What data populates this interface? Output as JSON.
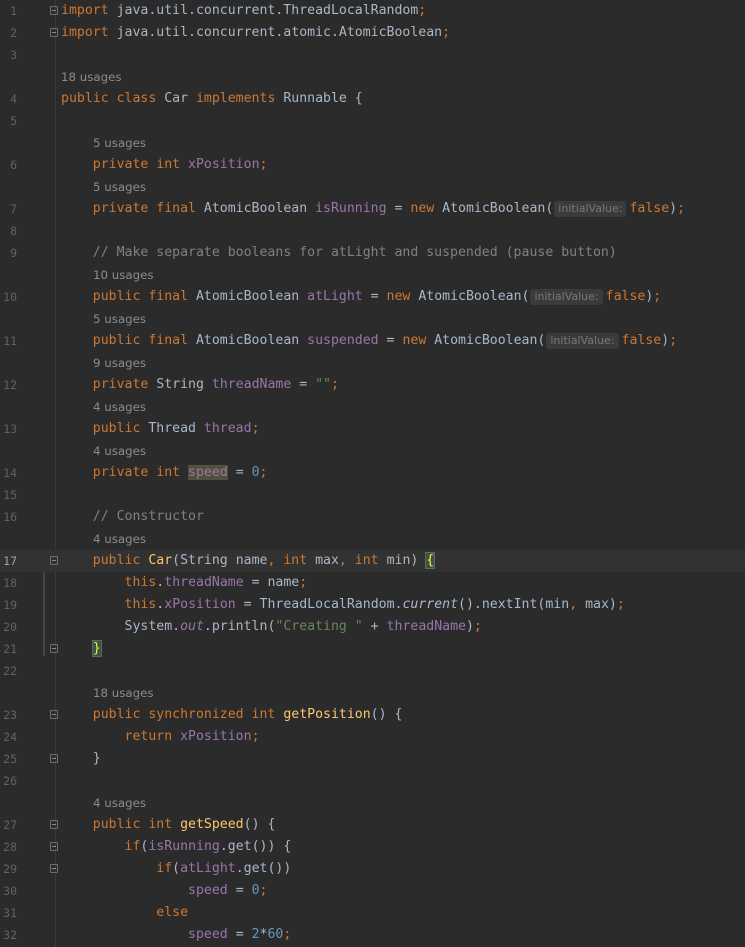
{
  "editor": {
    "language": "java",
    "colors": {
      "background": "#2b2b2b",
      "keyword": "#cc7832",
      "field": "#9876aa",
      "string": "#6a8759",
      "number": "#6897bb",
      "comment": "#808080",
      "method": "#ffc66d"
    },
    "lines": [
      {
        "num": "1",
        "fold": true,
        "tokens": [
          [
            "kw",
            "import"
          ],
          [
            "p",
            " java.util.concurrent.ThreadLocalRandom"
          ],
          [
            "kw",
            ";"
          ]
        ]
      },
      {
        "num": "2",
        "fold": true,
        "tokens": [
          [
            "kw",
            "import"
          ],
          [
            "p",
            " java.util.concurrent.atomic.AtomicBoolean"
          ],
          [
            "kw",
            ";"
          ]
        ]
      },
      {
        "num": "3",
        "tokens": []
      },
      {
        "usage": "18 usages",
        "indent": 0
      },
      {
        "num": "4",
        "tokens": [
          [
            "kw",
            "public class "
          ],
          [
            "p",
            "Car "
          ],
          [
            "kw",
            "implements "
          ],
          [
            "p",
            "Runnable {"
          ]
        ]
      },
      {
        "num": "5",
        "tokens": []
      },
      {
        "usage": "5 usages",
        "indent": 1
      },
      {
        "num": "6",
        "tokens": [
          [
            "p",
            "    "
          ],
          [
            "kw",
            "private int "
          ],
          [
            "fld",
            "xPosition"
          ],
          [
            "kw",
            ";"
          ]
        ]
      },
      {
        "usage": "5 usages",
        "indent": 1
      },
      {
        "num": "7",
        "tokens": [
          [
            "p",
            "    "
          ],
          [
            "kw",
            "private final "
          ],
          [
            "p",
            "AtomicBoolean "
          ],
          [
            "fld",
            "isRunning"
          ],
          [
            "p",
            " = "
          ],
          [
            "kw",
            "new "
          ],
          [
            "p",
            "AtomicBoolean("
          ],
          [
            "hint",
            "initialValue:"
          ],
          [
            "kw",
            "false"
          ],
          [
            "p",
            ")"
          ],
          [
            "kw",
            ";"
          ]
        ]
      },
      {
        "num": "8",
        "tokens": []
      },
      {
        "num": "9",
        "tokens": [
          [
            "p",
            "    "
          ],
          [
            "cm",
            "// Make separate booleans for atLight and suspended (pause button)"
          ]
        ]
      },
      {
        "usage": "10 usages",
        "indent": 1
      },
      {
        "num": "10",
        "tokens": [
          [
            "p",
            "    "
          ],
          [
            "kw",
            "public final "
          ],
          [
            "p",
            "AtomicBoolean "
          ],
          [
            "fld",
            "atLight"
          ],
          [
            "p",
            " = "
          ],
          [
            "kw",
            "new "
          ],
          [
            "p",
            "AtomicBoolean("
          ],
          [
            "hint",
            "initialValue:"
          ],
          [
            "kw",
            "false"
          ],
          [
            "p",
            ")"
          ],
          [
            "kw",
            ";"
          ]
        ]
      },
      {
        "usage": "5 usages",
        "indent": 1
      },
      {
        "num": "11",
        "tokens": [
          [
            "p",
            "    "
          ],
          [
            "kw",
            "public final "
          ],
          [
            "p",
            "AtomicBoolean "
          ],
          [
            "fld",
            "suspended"
          ],
          [
            "p",
            " = "
          ],
          [
            "kw",
            "new "
          ],
          [
            "p",
            "AtomicBoolean("
          ],
          [
            "hint",
            "initialValue:"
          ],
          [
            "kw",
            "false"
          ],
          [
            "p",
            ")"
          ],
          [
            "kw",
            ";"
          ]
        ]
      },
      {
        "usage": "9 usages",
        "indent": 1
      },
      {
        "num": "12",
        "tokens": [
          [
            "p",
            "    "
          ],
          [
            "kw",
            "private "
          ],
          [
            "p",
            "String "
          ],
          [
            "fld",
            "threadName"
          ],
          [
            "p",
            " = "
          ],
          [
            "str",
            "\"\""
          ],
          [
            "kw",
            ";"
          ]
        ]
      },
      {
        "usage": "4 usages",
        "indent": 1
      },
      {
        "num": "13",
        "tokens": [
          [
            "p",
            "    "
          ],
          [
            "kw",
            "public "
          ],
          [
            "p",
            "Thread "
          ],
          [
            "fld",
            "thread"
          ],
          [
            "kw",
            ";"
          ]
        ]
      },
      {
        "usage": "4 usages",
        "indent": 1
      },
      {
        "num": "14",
        "tokens": [
          [
            "p",
            "    "
          ],
          [
            "kw",
            "private int "
          ],
          [
            "fldhl",
            "speed"
          ],
          [
            "p",
            " = "
          ],
          [
            "num",
            "0"
          ],
          [
            "kw",
            ";"
          ]
        ]
      },
      {
        "num": "15",
        "tokens": []
      },
      {
        "num": "16",
        "tokens": [
          [
            "p",
            "    "
          ],
          [
            "cm",
            "// Constructor"
          ]
        ]
      },
      {
        "usage": "4 usages",
        "indent": 1
      },
      {
        "num": "17",
        "current": true,
        "fold": true,
        "tokens": [
          [
            "p",
            "    "
          ],
          [
            "kw",
            "public "
          ],
          [
            "fn",
            "Car"
          ],
          [
            "p",
            "(String name"
          ],
          [
            "kw",
            ", int "
          ],
          [
            "p",
            "max"
          ],
          [
            "kw",
            ", int "
          ],
          [
            "p",
            "min) "
          ],
          [
            "bracehl",
            "{"
          ]
        ]
      },
      {
        "num": "18",
        "tokens": [
          [
            "p",
            "        "
          ],
          [
            "kw",
            "this"
          ],
          [
            "p",
            "."
          ],
          [
            "fld",
            "threadName"
          ],
          [
            "p",
            " = name"
          ],
          [
            "kw",
            ";"
          ]
        ]
      },
      {
        "num": "19",
        "tokens": [
          [
            "p",
            "        "
          ],
          [
            "kw",
            "this"
          ],
          [
            "p",
            "."
          ],
          [
            "fld",
            "xPosition"
          ],
          [
            "p",
            " = ThreadLocalRandom."
          ],
          [
            "ital",
            "current"
          ],
          [
            "p",
            "().nextInt(min"
          ],
          [
            "kw",
            ", "
          ],
          [
            "p",
            "max)"
          ],
          [
            "kw",
            ";"
          ]
        ]
      },
      {
        "num": "20",
        "tokens": [
          [
            "p",
            "        System."
          ],
          [
            "fldital",
            "out"
          ],
          [
            "p",
            ".println("
          ],
          [
            "str",
            "\"Creating \""
          ],
          [
            "p",
            " + "
          ],
          [
            "fld",
            "threadName"
          ],
          [
            "p",
            ")"
          ],
          [
            "kw",
            ";"
          ]
        ]
      },
      {
        "num": "21",
        "fold": true,
        "tokens": [
          [
            "p",
            "    "
          ],
          [
            "bracehl",
            "}"
          ]
        ]
      },
      {
        "num": "22",
        "tokens": []
      },
      {
        "usage": "18 usages",
        "indent": 1
      },
      {
        "num": "23",
        "fold": true,
        "tokens": [
          [
            "p",
            "    "
          ],
          [
            "kw",
            "public synchronized int "
          ],
          [
            "fn",
            "getPosition"
          ],
          [
            "p",
            "() {"
          ]
        ]
      },
      {
        "num": "24",
        "tokens": [
          [
            "p",
            "        "
          ],
          [
            "kw",
            "return "
          ],
          [
            "fld",
            "xPosition"
          ],
          [
            "kw",
            ";"
          ]
        ]
      },
      {
        "num": "25",
        "fold": true,
        "tokens": [
          [
            "p",
            "    }"
          ]
        ]
      },
      {
        "num": "26",
        "tokens": []
      },
      {
        "usage": "4 usages",
        "indent": 1
      },
      {
        "num": "27",
        "fold": true,
        "tokens": [
          [
            "p",
            "    "
          ],
          [
            "kw",
            "public int "
          ],
          [
            "fn",
            "getSpeed"
          ],
          [
            "p",
            "() {"
          ]
        ]
      },
      {
        "num": "28",
        "fold": true,
        "tokens": [
          [
            "p",
            "        "
          ],
          [
            "kw",
            "if"
          ],
          [
            "p",
            "("
          ],
          [
            "fld",
            "isRunning"
          ],
          [
            "p",
            ".get()) {"
          ]
        ]
      },
      {
        "num": "29",
        "fold": true,
        "tokens": [
          [
            "p",
            "            "
          ],
          [
            "kw",
            "if"
          ],
          [
            "p",
            "("
          ],
          [
            "fld",
            "atLight"
          ],
          [
            "p",
            ".get())"
          ]
        ]
      },
      {
        "num": "30",
        "tokens": [
          [
            "p",
            "                "
          ],
          [
            "fld",
            "speed"
          ],
          [
            "p",
            " = "
          ],
          [
            "num",
            "0"
          ],
          [
            "kw",
            ";"
          ]
        ]
      },
      {
        "num": "31",
        "tokens": [
          [
            "p",
            "            "
          ],
          [
            "kw",
            "else"
          ]
        ]
      },
      {
        "num": "32",
        "tokens": [
          [
            "p",
            "                "
          ],
          [
            "fld",
            "speed"
          ],
          [
            "p",
            " = "
          ],
          [
            "num",
            "2"
          ],
          [
            "p",
            "*"
          ],
          [
            "num",
            "60"
          ],
          [
            "kw",
            ";"
          ]
        ]
      }
    ]
  }
}
